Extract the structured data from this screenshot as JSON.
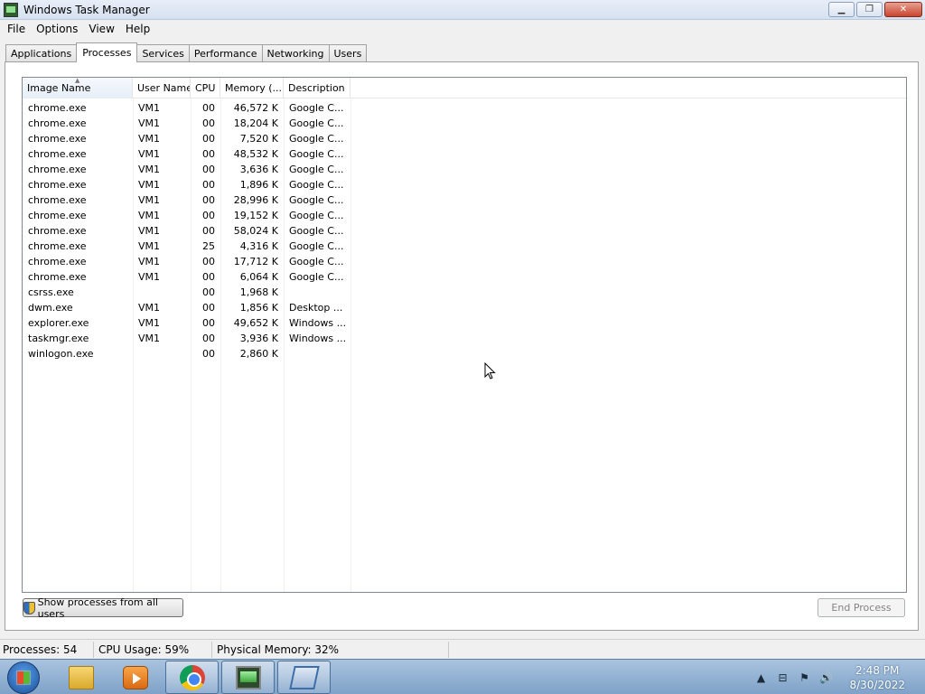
{
  "window": {
    "title": "Windows Task Manager",
    "controls": {
      "minimize": "▁",
      "restore": "❐",
      "close": "✕"
    }
  },
  "menu": [
    "File",
    "Options",
    "View",
    "Help"
  ],
  "tabs": [
    {
      "label": "Applications",
      "active": false
    },
    {
      "label": "Processes",
      "active": true
    },
    {
      "label": "Services",
      "active": false
    },
    {
      "label": "Performance",
      "active": false
    },
    {
      "label": "Networking",
      "active": false
    },
    {
      "label": "Users",
      "active": false
    }
  ],
  "columns": {
    "name": "Image Name",
    "user": "User Name",
    "cpu": "CPU",
    "memory": "Memory (...",
    "description": "Description"
  },
  "processes": [
    {
      "name": "chrome.exe",
      "user": "VM1",
      "cpu": "00",
      "memory": "46,572 K",
      "description": "Google C..."
    },
    {
      "name": "chrome.exe",
      "user": "VM1",
      "cpu": "00",
      "memory": "18,204 K",
      "description": "Google C..."
    },
    {
      "name": "chrome.exe",
      "user": "VM1",
      "cpu": "00",
      "memory": "7,520 K",
      "description": "Google C..."
    },
    {
      "name": "chrome.exe",
      "user": "VM1",
      "cpu": "00",
      "memory": "48,532 K",
      "description": "Google C..."
    },
    {
      "name": "chrome.exe",
      "user": "VM1",
      "cpu": "00",
      "memory": "3,636 K",
      "description": "Google C..."
    },
    {
      "name": "chrome.exe",
      "user": "VM1",
      "cpu": "00",
      "memory": "1,896 K",
      "description": "Google C..."
    },
    {
      "name": "chrome.exe",
      "user": "VM1",
      "cpu": "00",
      "memory": "28,996 K",
      "description": "Google C..."
    },
    {
      "name": "chrome.exe",
      "user": "VM1",
      "cpu": "00",
      "memory": "19,152 K",
      "description": "Google C..."
    },
    {
      "name": "chrome.exe",
      "user": "VM1",
      "cpu": "00",
      "memory": "58,024 K",
      "description": "Google C..."
    },
    {
      "name": "chrome.exe",
      "user": "VM1",
      "cpu": "25",
      "memory": "4,316 K",
      "description": "Google C..."
    },
    {
      "name": "chrome.exe",
      "user": "VM1",
      "cpu": "00",
      "memory": "17,712 K",
      "description": "Google C..."
    },
    {
      "name": "chrome.exe",
      "user": "VM1",
      "cpu": "00",
      "memory": "6,064 K",
      "description": "Google C..."
    },
    {
      "name": "csrss.exe",
      "user": "",
      "cpu": "00",
      "memory": "1,968 K",
      "description": ""
    },
    {
      "name": "dwm.exe",
      "user": "VM1",
      "cpu": "00",
      "memory": "1,856 K",
      "description": "Desktop ..."
    },
    {
      "name": "explorer.exe",
      "user": "VM1",
      "cpu": "00",
      "memory": "49,652 K",
      "description": "Windows ..."
    },
    {
      "name": "taskmgr.exe",
      "user": "VM1",
      "cpu": "00",
      "memory": "3,936 K",
      "description": "Windows ..."
    },
    {
      "name": "winlogon.exe",
      "user": "",
      "cpu": "00",
      "memory": "2,860 K",
      "description": ""
    }
  ],
  "buttons": {
    "show_all": "Show processes from all users",
    "end_process": "End Process"
  },
  "status": {
    "processes": "Processes: 54",
    "cpu": "CPU Usage: 59%",
    "memory": "Physical Memory: 32%"
  },
  "taskbar": {
    "apps": [
      "folder-icon",
      "media-player-icon",
      "chrome-icon",
      "task-manager-icon",
      "remote-desktop-icon"
    ],
    "tray_icons": {
      "show_hidden": "▲",
      "network": "⊟",
      "action_center": "⚑",
      "volume": "🔊"
    },
    "time": "2:48 PM",
    "date": "8/30/2022"
  }
}
